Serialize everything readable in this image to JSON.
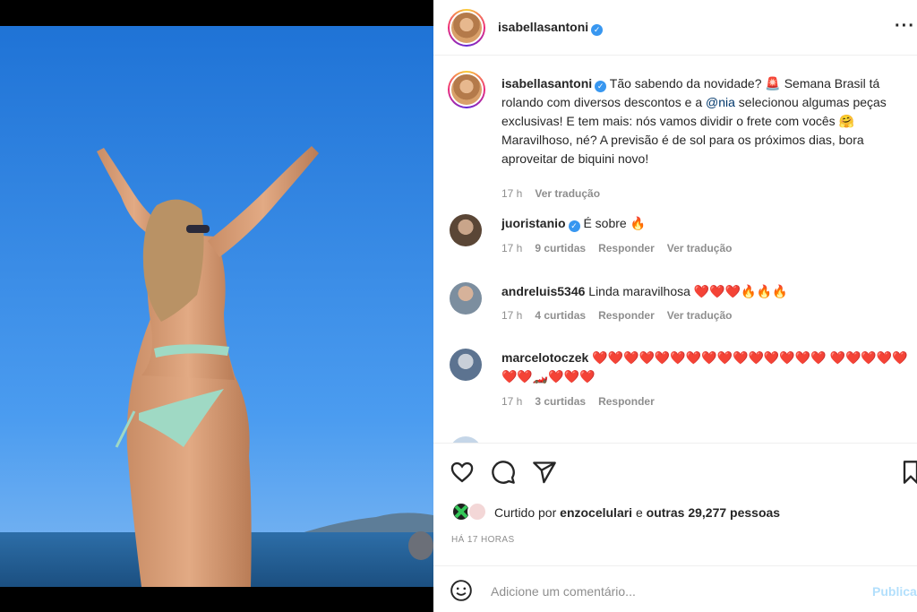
{
  "post": {
    "author": "isabellasantoni",
    "caption_parts": [
      "Tão sabendo da novidade? ",
      "🚨",
      " Semana Brasil tá rolando com diversos descontos e a ",
      "@nia",
      " selecionou algumas peças exclusivas! E tem mais: nós vamos dividir o frete com vocês ",
      "🤗",
      " Maravilhoso, né? A previsão é de sol para os próximos dias, bora aproveitar de biquini novo!"
    ],
    "caption_time": "17 h",
    "caption_translate": "Ver tradução"
  },
  "comments": [
    {
      "user": "juoristanio",
      "verified": true,
      "text": "É sobre 🔥",
      "time": "17 h",
      "likes": "9 curtidas",
      "reply": "Responder",
      "translate": "Ver tradução"
    },
    {
      "user": "andreluis5346",
      "verified": false,
      "text": "Linda maravilhosa ❤️❤️❤️🔥🔥🔥",
      "time": "17 h",
      "likes": "4 curtidas",
      "reply": "Responder",
      "translate": "Ver tradução"
    },
    {
      "user": "marcelotoczek",
      "verified": false,
      "text": "❤️❤️❤️❤️❤️❤️❤️❤️❤️❤️❤️❤️❤️❤️❤️ ❤️❤️❤️❤️❤️❤️❤️🏎️❤️❤️❤️",
      "time": "17 h",
      "likes": "3 curtidas",
      "reply": "Responder",
      "translate": ""
    }
  ],
  "likes": {
    "prefix": "Curtido por",
    "user": "enzocelulari",
    "connector": "e",
    "others": "outras 29,277 pessoas"
  },
  "time_ago": "HÁ 17 HORAS",
  "composer": {
    "placeholder": "Adicione um comentário...",
    "publish": "Publicar"
  },
  "icons": [
    "heart-icon",
    "comment-icon",
    "share-icon",
    "bookmark-icon",
    "emoji-icon",
    "more-icon",
    "verified-icon"
  ],
  "colors": {
    "verified": "#3897f0",
    "mention": "#00376b",
    "muted": "#8e8e8e",
    "publish_disabled": "#b2dffc"
  }
}
